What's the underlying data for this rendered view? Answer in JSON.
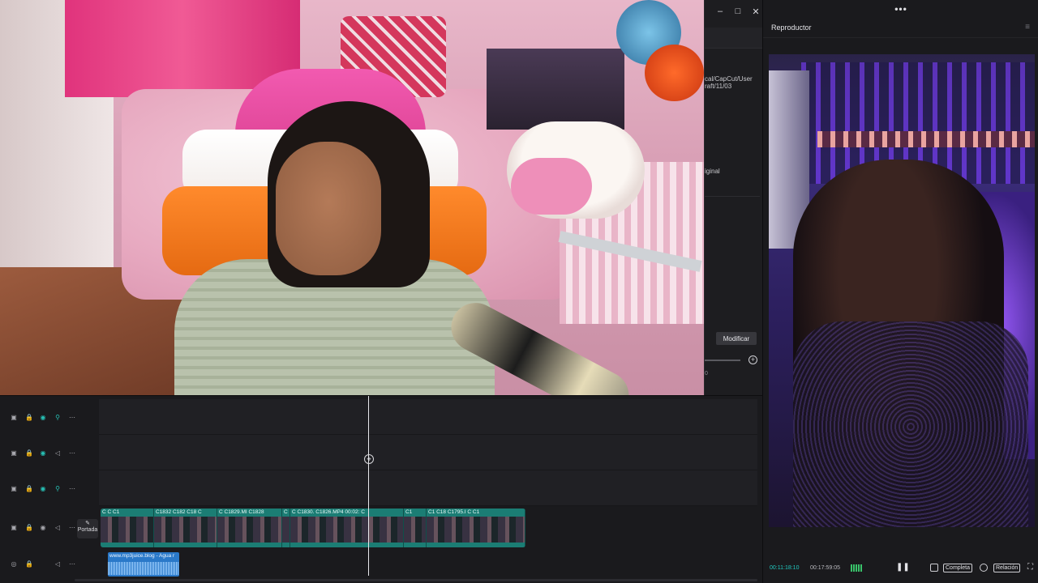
{
  "window_controls": {
    "minimize": "–",
    "maximize": "□",
    "close": "✕"
  },
  "side_panel": {
    "path": "cal/CapCut/User\nraft/11/03",
    "original_label": "iginal",
    "modify_button": "Modificar",
    "zoom_value": "0"
  },
  "player": {
    "top_dots": "•••",
    "title": "Reproductor",
    "menu_icon": "≡",
    "current_time": "00:11:18:10",
    "total_time": "00:17:59:05",
    "pause_icon": "❚❚",
    "full_label": "Completa",
    "ratio_label": "Relación",
    "fullscreen_icon": "⛶"
  },
  "timeline": {
    "tracks": [
      {
        "name": "track-1",
        "icons": [
          "▣",
          "🔒",
          "◉",
          "⚲",
          "⋯"
        ]
      },
      {
        "name": "track-2",
        "icons": [
          "▣",
          "🔒",
          "◉",
          "◁",
          "⋯"
        ]
      },
      {
        "name": "track-3",
        "icons": [
          "▣",
          "🔒",
          "◉",
          "⚲",
          "⋯"
        ]
      },
      {
        "name": "main-track",
        "icons": [
          "▣",
          "🔒",
          "◉",
          "◁",
          "⋯"
        ]
      },
      {
        "name": "audio-track",
        "icons": [
          "◎",
          "🔒",
          "",
          "◁",
          "⋯"
        ]
      }
    ],
    "cover_label": "Portada",
    "cover_icon": "✎",
    "video_clips": [
      {
        "label": "C C C1",
        "w": 66
      },
      {
        "label": "C1832 C182 C18 C",
        "w": 78
      },
      {
        "label": "C C1829.MI C1828",
        "w": 80
      },
      {
        "label": "C",
        "w": 10
      },
      {
        "label": "C C1830. C1826.MP4 00:02: C",
        "w": 140
      },
      {
        "label": "C1",
        "w": 28
      },
      {
        "label": "C1 C18 C1795.I C C1",
        "w": 122
      }
    ],
    "audio_clip": "www.mp3juice.blog - Agua r",
    "playhead_icon": "⌖"
  },
  "colors": {
    "accent_teal": "#21c9c0",
    "clip_teal": "#1b7d74",
    "audio_blue": "#2a79c9",
    "panel_bg": "#1a1a1d"
  }
}
